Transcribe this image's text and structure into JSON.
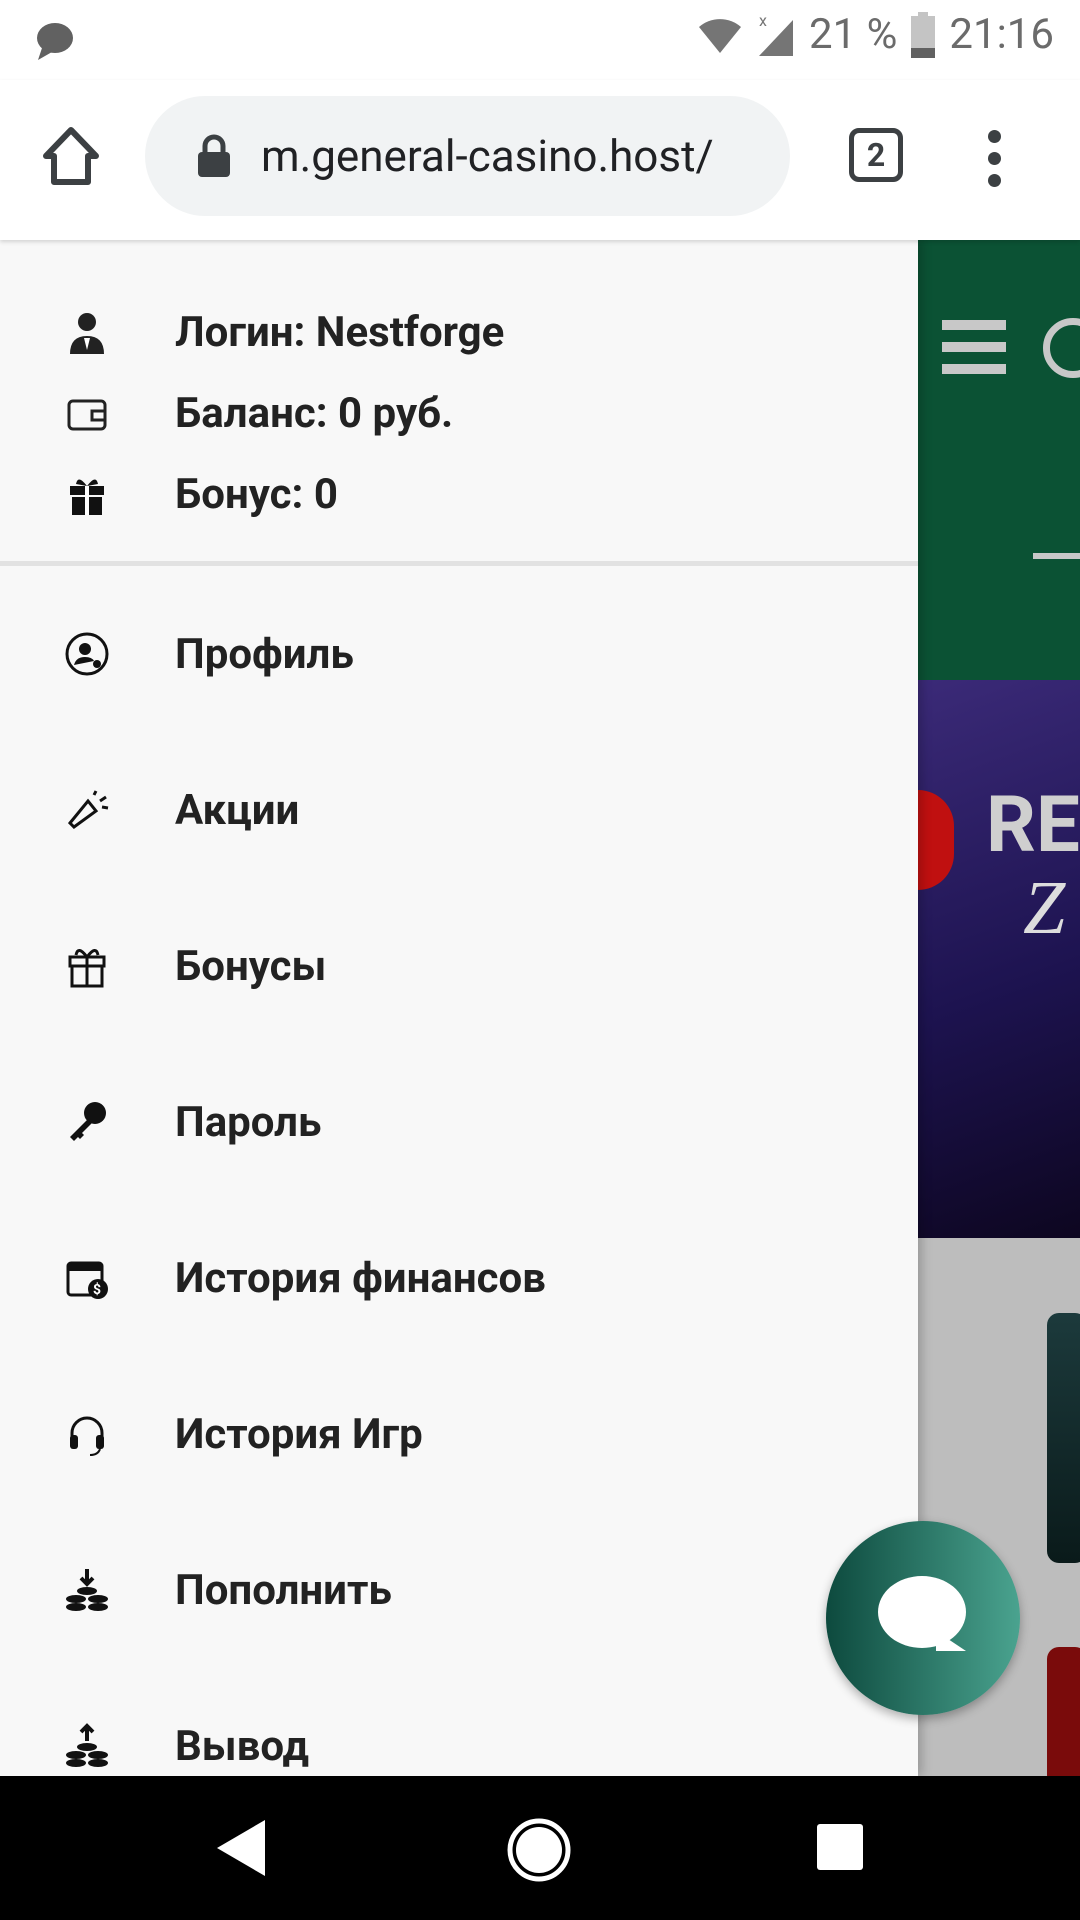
{
  "status_bar": {
    "battery": "21 %",
    "time": "21:16"
  },
  "browser": {
    "url": "m.general-casino.host/",
    "tab_count": "2"
  },
  "account": {
    "login": "Логин: Nestforge",
    "balance": "Баланс: 0 руб.",
    "bonus": "Бонус: 0"
  },
  "menu": [
    {
      "label": "Профиль",
      "icon": "profile-icon"
    },
    {
      "label": "Акции",
      "icon": "megaphone-icon"
    },
    {
      "label": "Бонусы",
      "icon": "gift-icon"
    },
    {
      "label": "Пароль",
      "icon": "key-icon"
    },
    {
      "label": "История финансов",
      "icon": "calendar-money-icon"
    },
    {
      "label": "История Игр",
      "icon": "headset-icon"
    },
    {
      "label": "Пополнить",
      "icon": "deposit-coins-icon"
    },
    {
      "label": "Вывод",
      "icon": "withdraw-coins-icon"
    }
  ],
  "banner": {
    "text1": "RE",
    "text2": "Z"
  }
}
